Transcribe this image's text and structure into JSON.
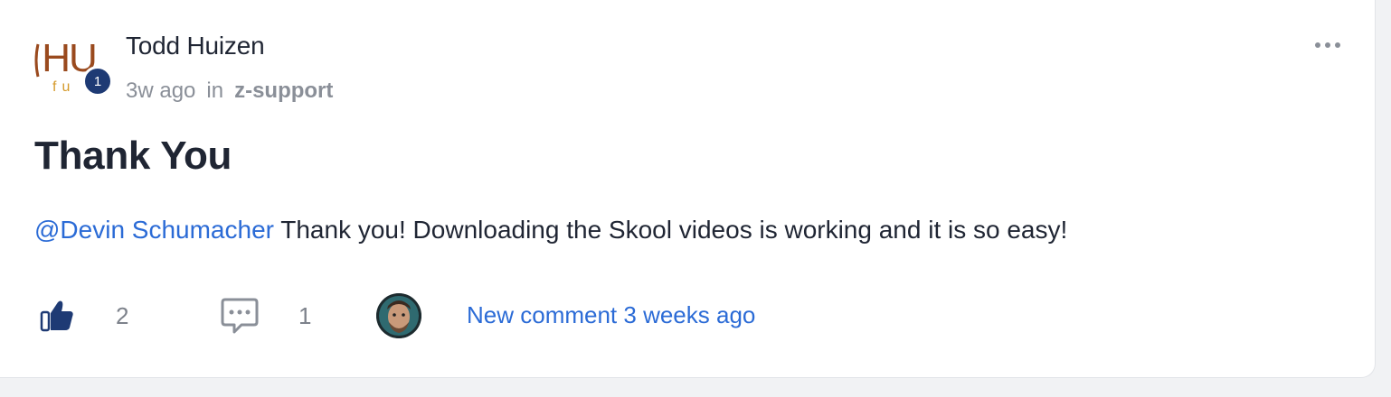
{
  "post": {
    "author": {
      "name": "Todd Huizen",
      "level": "1",
      "avatar_text": "HU fu"
    },
    "time_ago": "3w ago",
    "in_word": "in",
    "category": "z-support",
    "title": "Thank You",
    "body": {
      "mention": "@Devin Schumacher",
      "text": " Thank you! Downloading the Skool videos is working and it is so easy!"
    },
    "likes": "2",
    "comments": "1",
    "last_comment": "New comment 3 weeks ago"
  },
  "icons": {
    "more": "more-dots-icon",
    "like": "thumbs-up-icon",
    "comment": "comment-bubble-icon"
  },
  "colors": {
    "accent": "#2b6bd6",
    "badge": "#1e3a74",
    "text": "#1f2533",
    "muted": "#8a8f98",
    "like_icon": "#1e3a74"
  }
}
